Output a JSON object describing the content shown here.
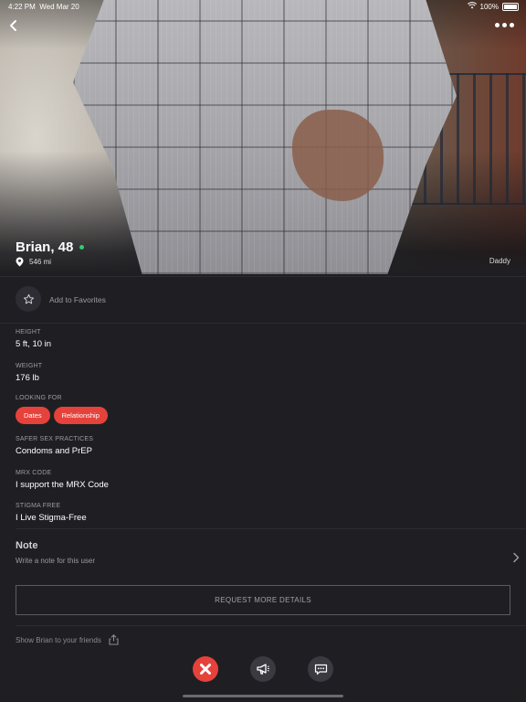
{
  "status": {
    "time": "4:22 PM",
    "date": "Wed Mar 20",
    "battery": "100%"
  },
  "profile": {
    "name": "Brian, 48",
    "distance": "546 mi",
    "tribe": "Daddy",
    "online": true
  },
  "favorites": {
    "label": "Add to Favorites"
  },
  "fields": {
    "height": {
      "label": "HEIGHT",
      "value": "5 ft, 10 in"
    },
    "weight": {
      "label": "WEIGHT",
      "value": "176 lb"
    },
    "looking_for": {
      "label": "LOOKING FOR",
      "tags": [
        "Dates",
        "Relationship"
      ]
    },
    "safer_sex": {
      "label": "SAFER SEX PRACTICES",
      "value": "Condoms and PrEP"
    },
    "mrx": {
      "label": "MRX CODE",
      "value": "I support the MRX Code"
    },
    "stigma": {
      "label": "STIGMA FREE",
      "value": "I Live Stigma-Free"
    }
  },
  "note": {
    "title": "Note",
    "placeholder": "Write a note for this user"
  },
  "request_button": "REQUEST MORE DETAILS",
  "share": {
    "label": "Show Brian to your friends"
  },
  "colors": {
    "accent": "#e5423b",
    "online": "#2ecc71",
    "background": "#1f1f23"
  },
  "icons": {
    "back": "chevron-left-icon",
    "more": "more-dots-icon",
    "location": "location-pin-icon",
    "favorite": "star-icon",
    "chevron": "chevron-right-icon",
    "share": "share-icon",
    "pass": "x-icon",
    "tap": "megaphone-icon",
    "chat": "chat-icon"
  }
}
